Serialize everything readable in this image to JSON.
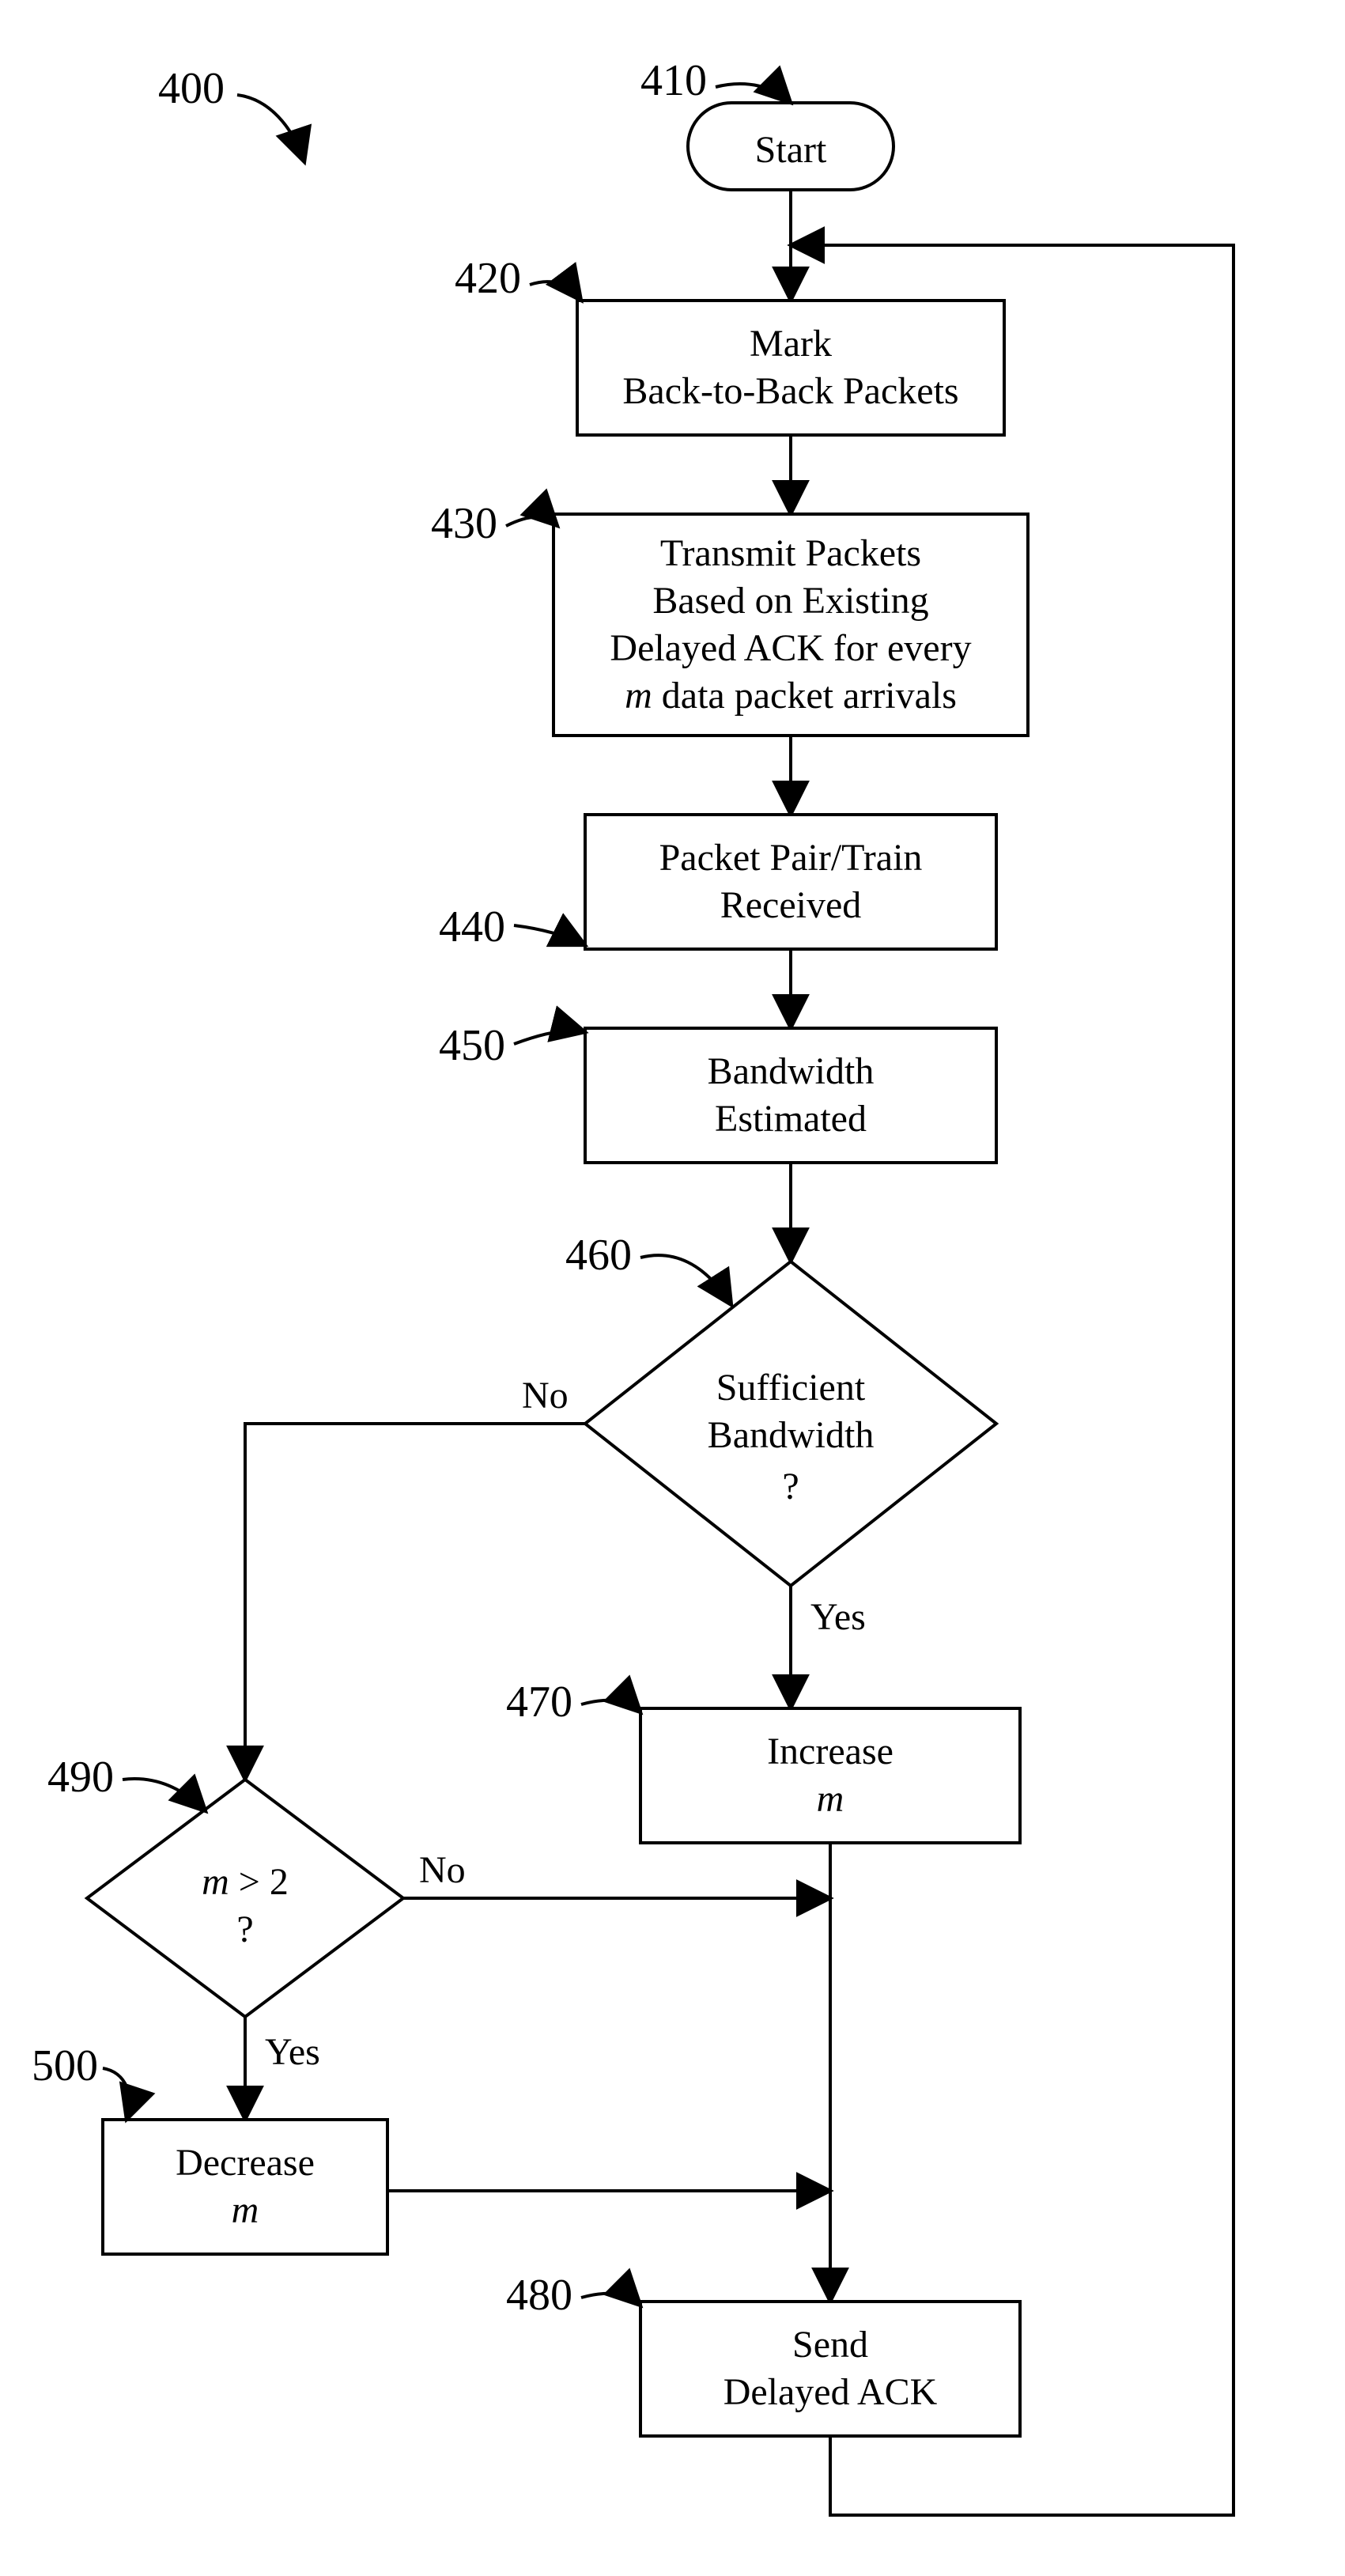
{
  "refs": {
    "r400": "400",
    "r410": "410",
    "r420": "420",
    "r430": "430",
    "r440": "440",
    "r450": "450",
    "r460": "460",
    "r470": "470",
    "r480": "480",
    "r490": "490",
    "r500": "500"
  },
  "labels": {
    "start": "Start",
    "n420_l1": "Mark",
    "n420_l2": "Back-to-Back Packets",
    "n430_l1": "Transmit Packets",
    "n430_l2": "Based on Existing",
    "n430_l3": "Delayed ACK for every",
    "n430_m": "m",
    "n430_l4": " data packet arrivals",
    "n440_l1": "Packet Pair/Train",
    "n440_l2": "Received",
    "n450_l1": "Bandwidth",
    "n450_l2": "Estimated",
    "n460_l1": "Sufficient",
    "n460_l2": "Bandwidth",
    "q": "?",
    "n470_l1": "Increase",
    "n480_l1": "Send",
    "n480_l2": "Delayed ACK",
    "n490_l1": "m",
    "n490_gt": " > 2",
    "n500_l1": "Decrease",
    "m": "m",
    "yes": "Yes",
    "no": "No"
  }
}
